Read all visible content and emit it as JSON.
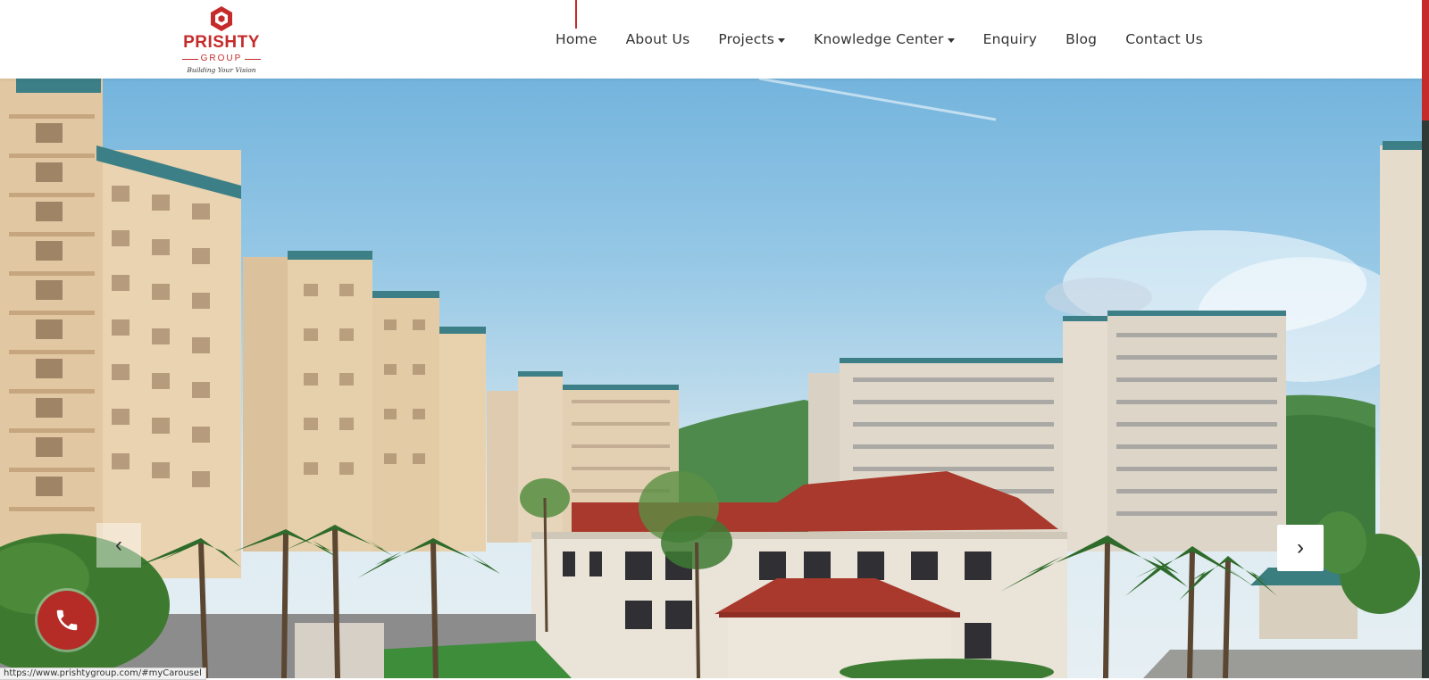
{
  "brand": {
    "name": "PRISHTY",
    "sub": "GROUP",
    "tagline": "Building Your Vision",
    "accent_color": "#c62b2b"
  },
  "nav": {
    "items": [
      {
        "label": "Home",
        "active": true,
        "dropdown": false
      },
      {
        "label": "About Us",
        "active": false,
        "dropdown": false
      },
      {
        "label": "Projects",
        "active": false,
        "dropdown": true
      },
      {
        "label": "Knowledge Center",
        "active": false,
        "dropdown": true
      },
      {
        "label": "Enquiry",
        "active": false,
        "dropdown": false
      },
      {
        "label": "Blog",
        "active": false,
        "dropdown": false
      },
      {
        "label": "Contact Us",
        "active": false,
        "dropdown": false
      }
    ]
  },
  "carousel": {
    "prev_icon": "chevron-left-icon",
    "next_icon": "chevron-right-icon",
    "prev_glyph": "‹",
    "next_glyph": "›"
  },
  "call_button": {
    "icon": "phone-icon",
    "color": "#b52b26"
  },
  "status_bar": {
    "url": "https://www.prishtygroup.com/#myCarousel"
  },
  "scrollbar": {
    "thumb_color": "#c62b2b",
    "track_color": "#2f3a36"
  }
}
